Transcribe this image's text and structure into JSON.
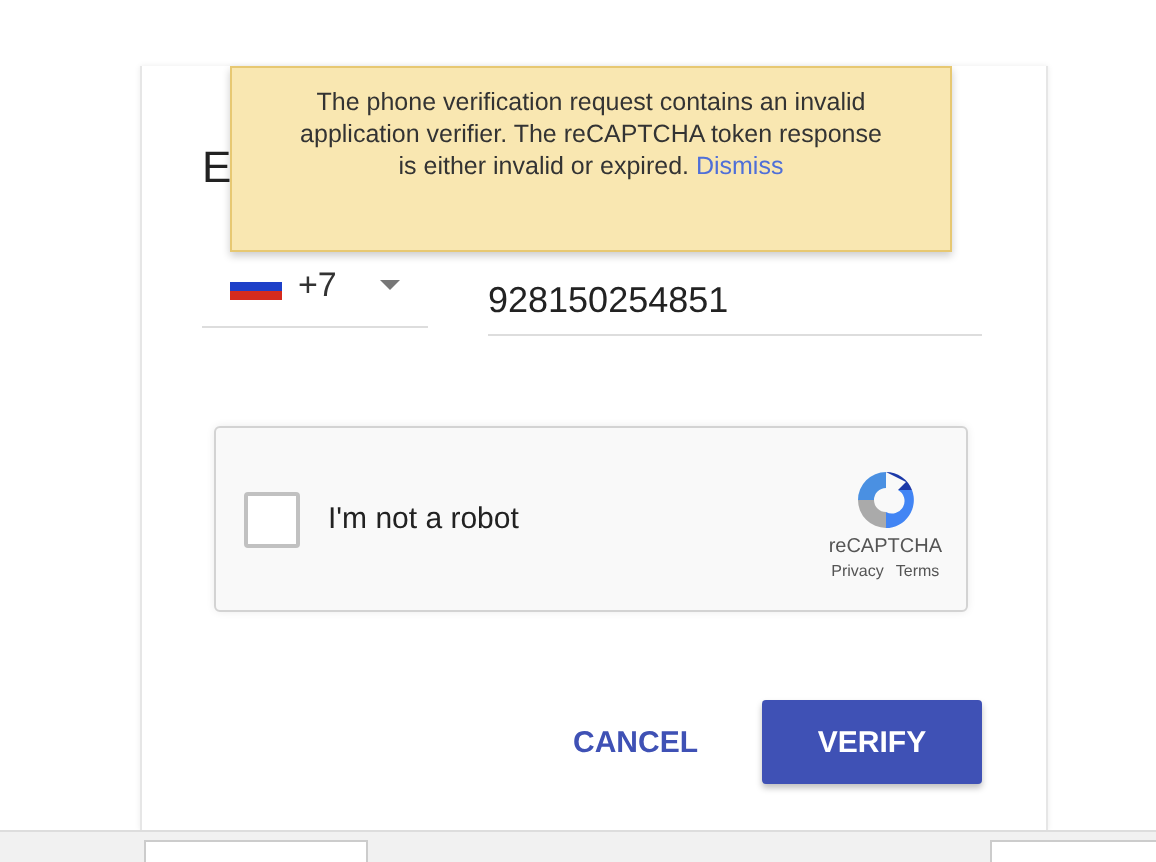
{
  "dialog": {
    "heading": "E",
    "country": {
      "code": "+7"
    },
    "phone": {
      "value": "928150254851"
    },
    "captcha": {
      "checked": false,
      "label": "I'm not a robot",
      "brand": "reCAPTCHA",
      "links": [
        "Privacy",
        "Terms"
      ]
    },
    "buttons": [
      {
        "kind": "text",
        "label": "CANCEL"
      },
      {
        "kind": "primary",
        "label": "VERIFY"
      }
    ]
  },
  "toast": {
    "message": "The phone verification request contains an invalid application verifier. The reCAPTCHA token response is either invalid or expired.",
    "action": "Dismiss"
  }
}
